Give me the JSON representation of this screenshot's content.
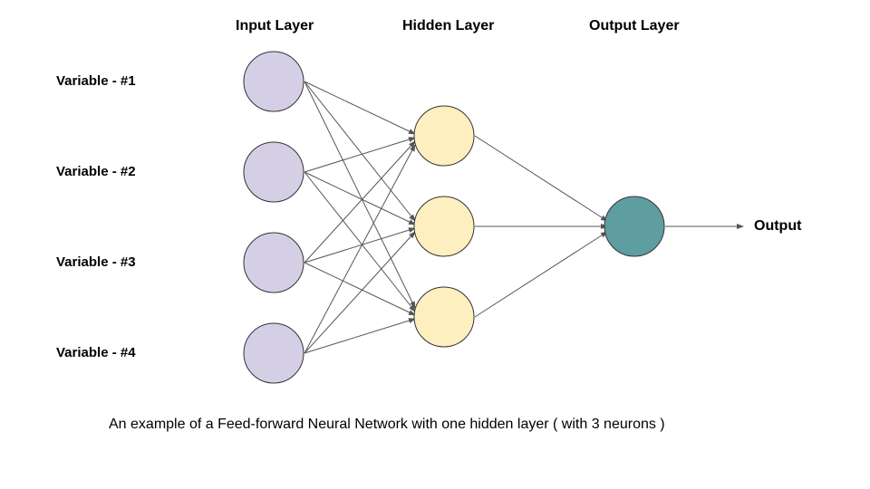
{
  "labels": {
    "input": "Input Layer",
    "hidden": "Hidden Layer",
    "output_layer": "Output Layer",
    "output_text": "Output",
    "var1": "Variable - #1",
    "var2": "Variable - #2",
    "var3": "Variable - #3",
    "var4": "Variable - #4",
    "caption": "An example of a Feed-forward Neural Network with one hidden layer ( with 3 neurons )"
  },
  "colors": {
    "input_fill": "#d5cfe6",
    "input_stroke": "#333333",
    "hidden_fill": "#fdefc0",
    "hidden_stroke": "#333333",
    "output_fill": "#5f9ea0",
    "output_stroke": "#333333",
    "edge": "#555555"
  },
  "chart_data": {
    "type": "diagram",
    "title": "Feed-forward Neural Network",
    "layers": [
      {
        "name": "Input Layer",
        "neuron_count": 4,
        "inputs": [
          "Variable - #1",
          "Variable - #2",
          "Variable - #3",
          "Variable - #4"
        ]
      },
      {
        "name": "Hidden Layer",
        "neuron_count": 3
      },
      {
        "name": "Output Layer",
        "neuron_count": 1,
        "outputs": [
          "Output"
        ]
      }
    ],
    "connections": "fully-connected-forward",
    "node_radius_px": 32
  }
}
